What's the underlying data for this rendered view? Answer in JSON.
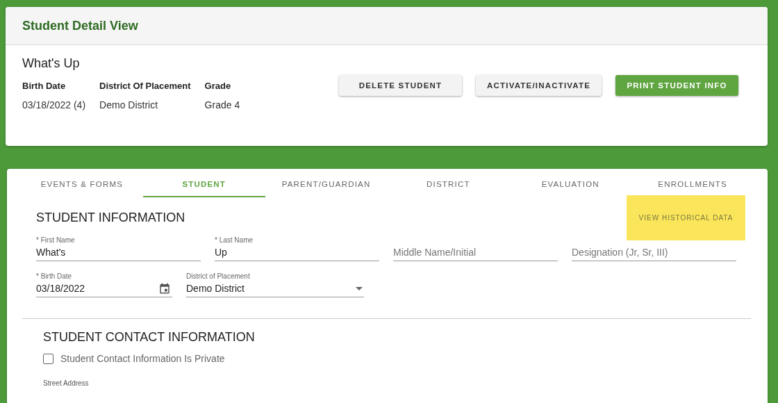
{
  "header": {
    "title": "Student Detail View"
  },
  "summary": {
    "name": "What's Up",
    "facts": [
      {
        "label": "Birth Date",
        "value": "03/18/2022 (4)"
      },
      {
        "label": "District Of Placement",
        "value": "Demo District"
      },
      {
        "label": "Grade",
        "value": "Grade 4"
      }
    ],
    "buttons": [
      {
        "label": "DELETE STUDENT",
        "kind": "plain"
      },
      {
        "label": "ACTIVATE/INACTIVATE",
        "kind": "plain"
      },
      {
        "label": "PRINT STUDENT INFO",
        "kind": "primary"
      }
    ]
  },
  "tabs": [
    {
      "label": "EVENTS & FORMS",
      "selected": false
    },
    {
      "label": "STUDENT",
      "selected": true
    },
    {
      "label": "PARENT/GUARDIAN",
      "selected": false
    },
    {
      "label": "DISTRICT",
      "selected": false
    },
    {
      "label": "EVALUATION",
      "selected": false
    },
    {
      "label": "ENROLLMENTS",
      "selected": false
    }
  ],
  "student_information": {
    "title": "STUDENT INFORMATION",
    "history_button": "VIEW HISTORICAL DATA",
    "rows": [
      [
        {
          "kind": "text",
          "label": "* First Name",
          "value": "What's"
        },
        {
          "kind": "text",
          "label": "* Last Name",
          "value": "Up"
        },
        {
          "kind": "text",
          "placeholder": "Middle Name/Initial"
        },
        {
          "kind": "text",
          "placeholder": "Designation (Jr, Sr, III)"
        }
      ],
      [
        {
          "kind": "date",
          "label": "* Birth Date",
          "value": "03/18/2022"
        },
        {
          "kind": "select",
          "label": "District of Placement",
          "value": "Demo District"
        }
      ]
    ]
  },
  "contact_information": {
    "title": "STUDENT CONTACT INFORMATION",
    "private_checkbox": {
      "label": "Student Contact Information Is Private",
      "checked": false
    },
    "street_address_label": "Street Address"
  }
}
